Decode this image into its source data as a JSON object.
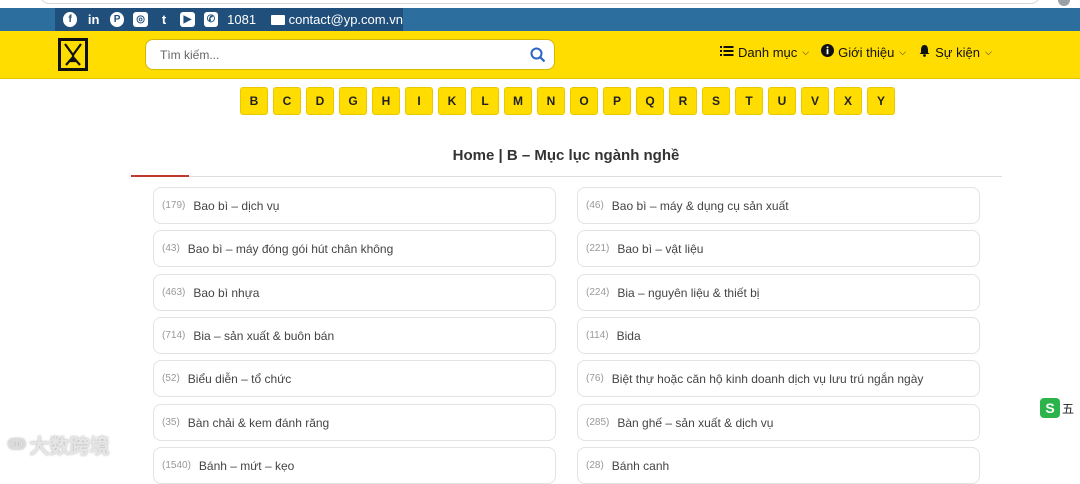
{
  "topbar": {
    "social_icons": [
      {
        "name": "facebook-icon",
        "glyph": "f"
      },
      {
        "name": "linkedin-icon",
        "glyph": "in"
      },
      {
        "name": "pinterest-icon",
        "glyph": "P"
      },
      {
        "name": "instagram-icon",
        "glyph": "◎"
      },
      {
        "name": "tumblr-icon",
        "glyph": "t"
      },
      {
        "name": "youtube-icon",
        "glyph": "▶"
      }
    ],
    "phone": "1081",
    "email": "contact@yp.com.vn"
  },
  "header": {
    "search_placeholder": "Tìm kiếm...",
    "nav": [
      {
        "label": "Danh mục",
        "icon": "list-icon"
      },
      {
        "label": "Giới thiệu",
        "icon": "info-icon"
      },
      {
        "label": "Sự kiện",
        "icon": "bell-icon"
      }
    ]
  },
  "letters": [
    "B",
    "C",
    "D",
    "G",
    "H",
    "I",
    "K",
    "L",
    "M",
    "N",
    "O",
    "P",
    "Q",
    "R",
    "S",
    "T",
    "U",
    "V",
    "X",
    "Y"
  ],
  "page_title": "Home | B – Mục lục ngành nghề",
  "categories": [
    {
      "count": "(179)",
      "name": "Bao bì – dịch vụ"
    },
    {
      "count": "(46)",
      "name": "Bao bì – máy & dụng cụ sản xuất"
    },
    {
      "count": "(43)",
      "name": "Bao bì – máy đóng gói hút chân không"
    },
    {
      "count": "(221)",
      "name": "Bao bì – vật liệu"
    },
    {
      "count": "(463)",
      "name": "Bao bì nhựa"
    },
    {
      "count": "(224)",
      "name": "Bia – nguyên liệu & thiết bị"
    },
    {
      "count": "(714)",
      "name": "Bia – sản xuất & buôn bán"
    },
    {
      "count": "(114)",
      "name": "Bida"
    },
    {
      "count": "(52)",
      "name": "Biểu diễn – tổ chức"
    },
    {
      "count": "(76)",
      "name": "Biệt thự hoặc căn hộ kinh doanh dịch vụ lưu trú ngắn ngày"
    },
    {
      "count": "(35)",
      "name": "Bàn chải & kem đánh răng"
    },
    {
      "count": "(285)",
      "name": "Bàn ghế – sản xuất & dịch vụ"
    },
    {
      "count": "(1540)",
      "name": "Bánh – mứt – kẹo"
    },
    {
      "count": "(28)",
      "name": "Bánh canh"
    }
  ],
  "widget_label": "五",
  "watermark_text": "大数跨境",
  "colors": {
    "topbar": "#2c6f9e",
    "topbar_inner": "#1f4f7a",
    "header": "#ffdd00",
    "accent_rule": "#c0392b"
  }
}
